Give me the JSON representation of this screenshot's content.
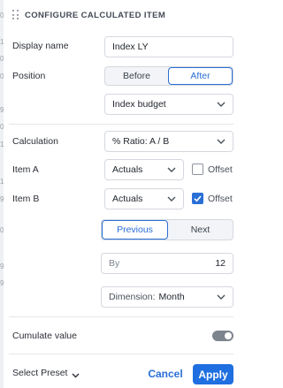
{
  "header": {
    "title": "CONFIGURE CALCULATED ITEM"
  },
  "edge_chars": [
    "0",
    "1",
    "0",
    "0",
    "9",
    "0",
    "1",
    "1",
    "9",
    "0",
    "9",
    "9"
  ],
  "display_name": {
    "label": "Display name",
    "value": "Index LY"
  },
  "position": {
    "label": "Position",
    "options": [
      "Before",
      "After"
    ],
    "selected": "After",
    "reference_item": "Index budget"
  },
  "calculation": {
    "label": "Calculation",
    "value": "% Ratio: A / B"
  },
  "item_a": {
    "label": "Item A",
    "value": "Actuals",
    "offset_label": "Offset",
    "offset_checked": false
  },
  "item_b": {
    "label": "Item B",
    "value": "Actuals",
    "offset_label": "Offset",
    "offset_checked": true
  },
  "offset": {
    "direction_options": [
      "Previous",
      "Next"
    ],
    "selected_direction": "Previous",
    "by_label": "By",
    "by_value": "12",
    "dimension_label": "Dimension:",
    "dimension_value": "Month"
  },
  "cumulate": {
    "label": "Cumulate value",
    "enabled": false
  },
  "footer": {
    "preset_label": "Select Preset",
    "cancel_label": "Cancel",
    "apply_label": "Apply"
  },
  "colors": {
    "accent": "#2a6fd6",
    "apply_bg": "#1f6fe0",
    "toggle_off": "#7d848e"
  }
}
